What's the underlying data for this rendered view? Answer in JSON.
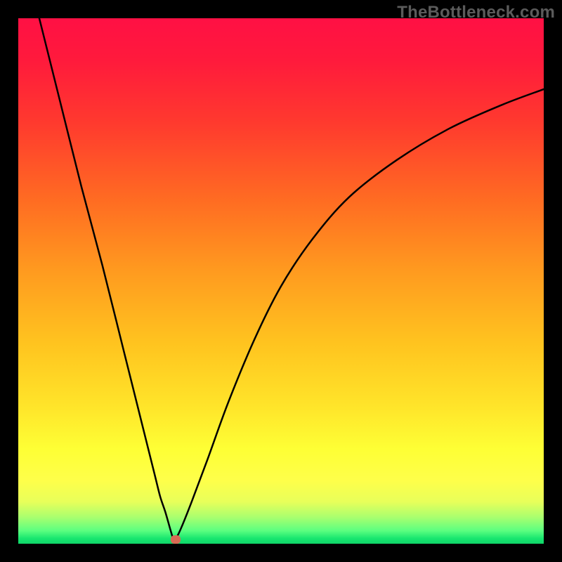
{
  "watermark": "TheBottleneck.com",
  "colors": {
    "frame": "#000000",
    "curve": "#000000",
    "marker": "#d86a54"
  },
  "chart_data": {
    "type": "line",
    "title": "",
    "xlabel": "",
    "ylabel": "",
    "xlim": [
      0,
      100
    ],
    "ylim": [
      0,
      100
    ],
    "grid": false,
    "legend": false,
    "note": "Values are estimated from the plotted curve shape (no axis tick labels present). x is fraction across horizontal extent (0..100), y is fraction of vertical extent (0 = bottom, 100 = top).",
    "series": [
      {
        "name": "left-branch",
        "x": [
          4,
          8,
          12,
          16,
          20,
          24,
          26,
          27,
          28,
          29,
          29.5
        ],
        "y": [
          100,
          84,
          68,
          53,
          37,
          21,
          13,
          9,
          6,
          2.5,
          1.0
        ]
      },
      {
        "name": "right-branch",
        "x": [
          30,
          31,
          33,
          36,
          40,
          45,
          50,
          56,
          63,
          72,
          82,
          92,
          100
        ],
        "y": [
          1.0,
          3,
          8,
          16,
          27,
          39,
          49,
          58,
          66,
          73,
          79,
          83.5,
          86.5
        ]
      }
    ],
    "marker": {
      "x": 30,
      "y": 0.8,
      "label": "optimum"
    },
    "gradient_bands": [
      {
        "label": "red",
        "from": 92,
        "to": 100
      },
      {
        "label": "orange",
        "from": 55,
        "to": 92
      },
      {
        "label": "yellow",
        "from": 12,
        "to": 55
      },
      {
        "label": "green",
        "from": 0,
        "to": 12
      }
    ]
  }
}
